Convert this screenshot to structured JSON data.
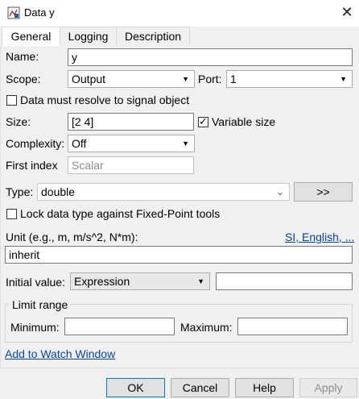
{
  "window": {
    "title": "Data y",
    "close": "✕"
  },
  "tabs": [
    "General",
    "Logging",
    "Description"
  ],
  "name": {
    "label": "Name:",
    "value": "y"
  },
  "scope": {
    "label": "Scope:",
    "value": "Output"
  },
  "port": {
    "label": "Port:",
    "value": "1"
  },
  "resolve": {
    "label": "Data must resolve to signal object",
    "checked": false
  },
  "size": {
    "label": "Size:",
    "value": "[2 4]"
  },
  "variable_size": {
    "label": "Variable size",
    "checked": true
  },
  "complexity": {
    "label": "Complexity:",
    "value": "Off"
  },
  "first_index": {
    "label": "First index",
    "placeholder": "Scalar"
  },
  "type": {
    "label": "Type:",
    "value": "double",
    "assistant_button": ">>"
  },
  "lock": {
    "label": "Lock data type against Fixed-Point tools",
    "checked": false
  },
  "unit": {
    "label": "Unit (e.g., m, m/s^2, N*m):",
    "link": "SI, English, ...",
    "value": "inherit"
  },
  "initial_value": {
    "label": "Initial value:",
    "mode": "Expression",
    "value": ""
  },
  "limit_range": {
    "title": "Limit range",
    "minimum_label": "Minimum:",
    "maximum_label": "Maximum:",
    "minimum": "",
    "maximum": ""
  },
  "watch_link": "Add to Watch Window",
  "buttons": {
    "ok": "OK",
    "cancel": "Cancel",
    "help": "Help",
    "apply": "Apply"
  }
}
